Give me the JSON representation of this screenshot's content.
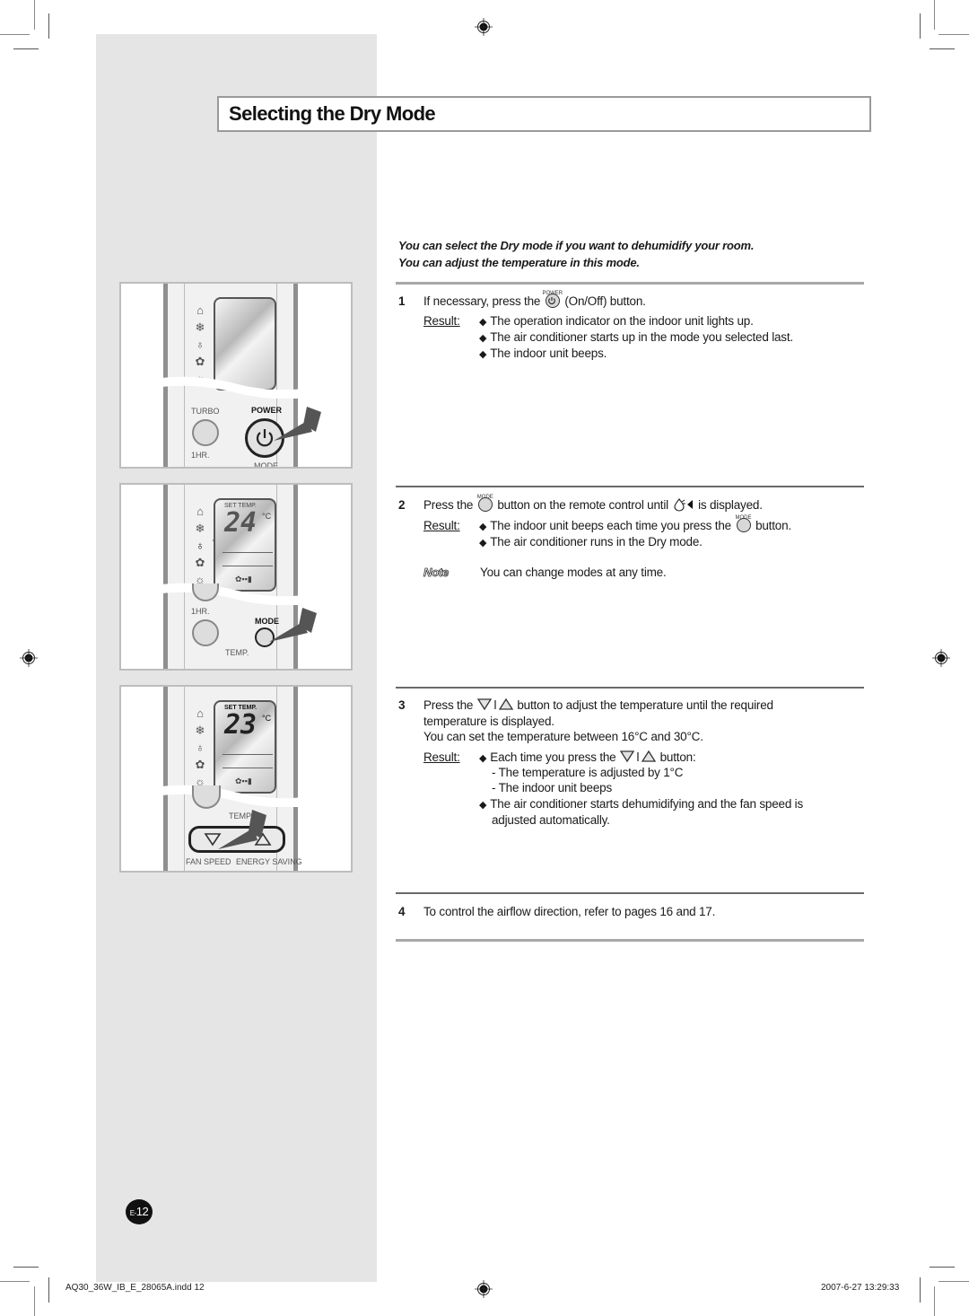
{
  "page": {
    "title": "Selecting the Dry Mode",
    "intro": [
      "You can select the Dry mode if you want to dehumidify your room.",
      "You can adjust the temperature in this mode."
    ],
    "page_label_prefix": "E-",
    "page_number": "12"
  },
  "steps": [
    {
      "number": "1",
      "text_before": "If necessary, press the",
      "button_caption": "POWER",
      "button_icon": "power-icon",
      "text_after": "(On/Off) button.",
      "result_label": "Result:",
      "results": [
        "The operation indicator on the indoor unit lights up.",
        "The air conditioner starts up in the mode you selected last.",
        "The indoor unit beeps."
      ]
    },
    {
      "number": "2",
      "text_before": "Press the",
      "button_caption": "MODE",
      "text_middle": "button on the remote control until",
      "mode_icon": "dry-mode-icon",
      "text_after": "is displayed.",
      "result_label": "Result:",
      "result_1_before": "The indoor unit beeps each time you press the",
      "result_1_caption": "MODE",
      "result_1_after": "button.",
      "result_2": "The air conditioner runs in the Dry mode.",
      "note_label": "Note",
      "note_text": "You can change modes at any time."
    },
    {
      "number": "3",
      "line_1_before": "Press the",
      "line_1_after": "button to adjust the temperature until the required",
      "line_2": "temperature is displayed.",
      "line_3": "You can set the temperature between 16°C and 30°C.",
      "result_label": "Result:",
      "result_1_before": "Each time you press the",
      "result_1_after": "button:",
      "sub_items": [
        "- The temperature is adjusted by 1°C",
        "- The indoor unit beeps"
      ],
      "result_2_line_1": "The air conditioner starts dehumidifying and the fan speed is",
      "result_2_line_2": "adjusted automatically."
    },
    {
      "number": "4",
      "text": "To control the airflow direction, refer to pages 16 and 17."
    }
  ],
  "illustrations": [
    {
      "labels": {
        "turbo": "TURBO",
        "power": "POWER",
        "one_hr": "1HR.",
        "mode": "MODE"
      },
      "display": ""
    },
    {
      "labels": {
        "set_temp": "SET TEMP.",
        "one_hr": "1HR.",
        "mode": "MODE",
        "temp": "TEMP."
      },
      "display": "24",
      "unit": "°C"
    },
    {
      "labels": {
        "set_temp": "SET TEMP.",
        "temp": "TEMP",
        "fan_speed": "FAN SPEED",
        "energy_saving": "ENERGY SAVING"
      },
      "display": "23",
      "unit": "°C"
    }
  ],
  "footer": {
    "file": "AQ30_36W_IB_E_28065A.indd   12",
    "timestamp": "2007-6-27   13:29:33"
  }
}
